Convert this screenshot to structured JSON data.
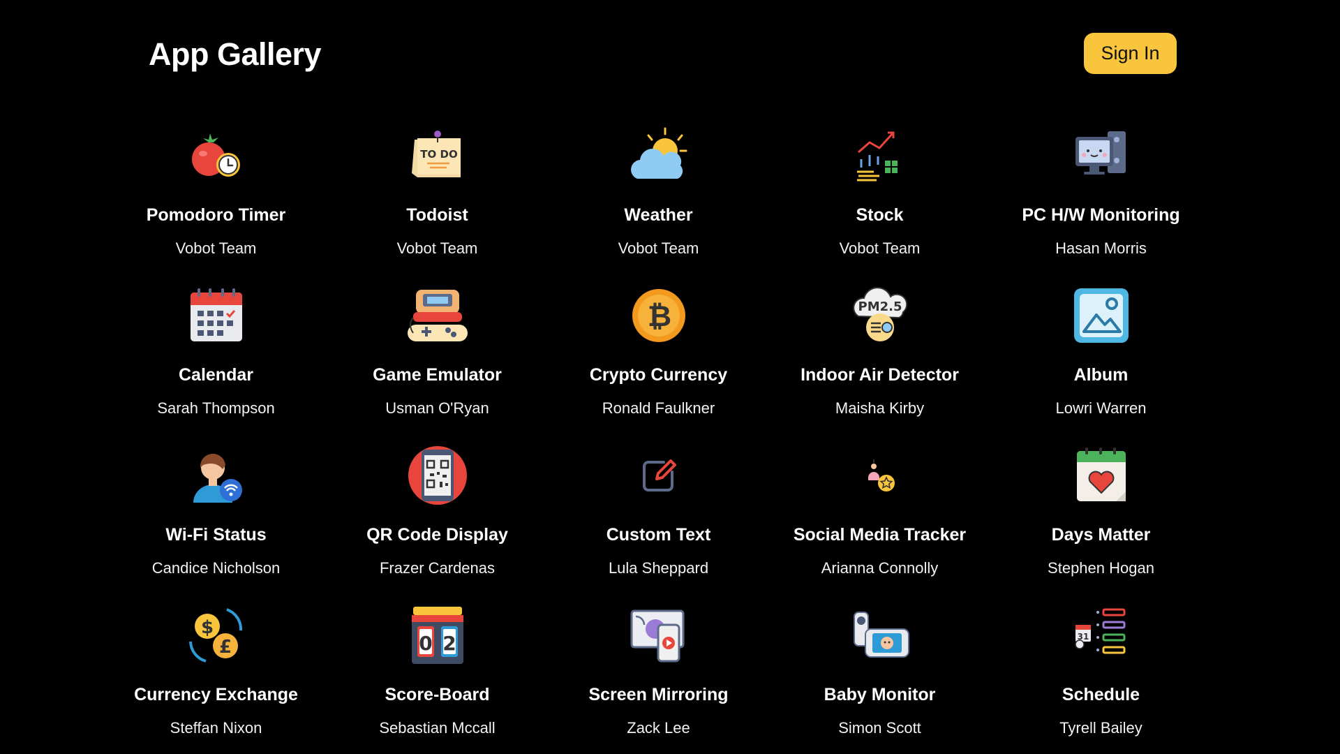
{
  "header": {
    "title": "App Gallery",
    "signin_label": "Sign In"
  },
  "colors": {
    "background": "#000000",
    "accent": "#F9C53D"
  },
  "apps": [
    {
      "name": "Pomodoro Timer",
      "author": "Vobot Team",
      "icon": "tomato-timer-icon"
    },
    {
      "name": "Todoist",
      "author": "Vobot Team",
      "icon": "todo-note-icon"
    },
    {
      "name": "Weather",
      "author": "Vobot Team",
      "icon": "sun-cloud-icon"
    },
    {
      "name": "Stock",
      "author": "Vobot Team",
      "icon": "stock-chart-icon"
    },
    {
      "name": "PC H/W Monitoring",
      "author": "Hasan Morris",
      "icon": "pc-monitor-icon"
    },
    {
      "name": "Calendar",
      "author": "Sarah Thompson",
      "icon": "calendar-icon"
    },
    {
      "name": "Game Emulator",
      "author": "Usman O'Ryan",
      "icon": "game-console-icon"
    },
    {
      "name": "Crypto Currency",
      "author": "Ronald Faulkner",
      "icon": "bitcoin-icon"
    },
    {
      "name": "Indoor Air Detector",
      "author": "Maisha Kirby",
      "icon": "pm25-cloud-icon"
    },
    {
      "name": "Album",
      "author": "Lowri Warren",
      "icon": "image-album-icon"
    },
    {
      "name": "Wi-Fi Status",
      "author": "Candice Nicholson",
      "icon": "person-wifi-icon"
    },
    {
      "name": "QR Code Display",
      "author": "Frazer Cardenas",
      "icon": "qr-code-icon"
    },
    {
      "name": "Custom Text",
      "author": "Lula Sheppard",
      "icon": "edit-pencil-icon"
    },
    {
      "name": "Social Media Tracker",
      "author": "Arianna Connolly",
      "icon": "person-star-icon"
    },
    {
      "name": "Days Matter",
      "author": "Stephen Hogan",
      "icon": "heart-calendar-icon"
    },
    {
      "name": "Currency Exchange",
      "author": "Steffan Nixon",
      "icon": "currency-exchange-icon"
    },
    {
      "name": "Score-Board",
      "author": "Sebastian Mccall",
      "icon": "scoreboard-icon"
    },
    {
      "name": "Screen Mirroring",
      "author": "Zack Lee",
      "icon": "screen-mirror-icon"
    },
    {
      "name": "Baby Monitor",
      "author": "Simon Scott",
      "icon": "baby-monitor-icon"
    },
    {
      "name": "Schedule",
      "author": "Tyrell Bailey",
      "icon": "schedule-list-icon"
    }
  ]
}
